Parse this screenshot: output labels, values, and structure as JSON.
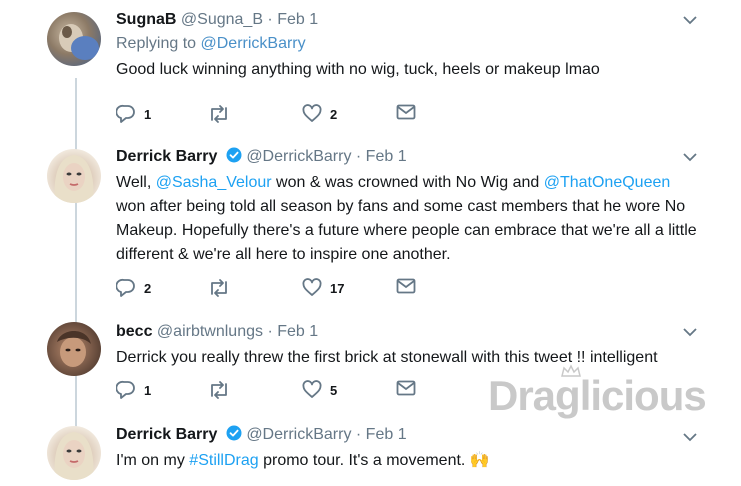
{
  "tweets": [
    {
      "name": "SugnaB",
      "handle": "@Sugna_B",
      "sep": " · ",
      "date": "Feb 1",
      "verified": false,
      "reply_prefix": "Replying to ",
      "reply_handle": "@DerrickBarry",
      "text": "Good luck winning anything with no wig, tuck, heels or makeup lmao",
      "replies": "1",
      "retweets": "",
      "likes": "2"
    },
    {
      "name": "Derrick Barry",
      "handle": "@DerrickBarry",
      "sep": " · ",
      "date": "Feb 1",
      "verified": true,
      "text_parts": [
        "Well, ",
        "@Sasha_Velour",
        " won & was crowned with No Wig and ",
        "@ThatOneQueen",
        " won after being told all season by fans and some cast members that he wore No Makeup. Hopefully there's a future where people can embrace that we're all a little different & we're all here to inspire one another."
      ],
      "replies": "2",
      "retweets": "",
      "likes": "17"
    },
    {
      "name": "becc",
      "handle": "@airbtwnlungs",
      "sep": " · ",
      "date": "Feb 1",
      "verified": false,
      "text": "Derrick you really threw the first brick at stonewall with this tweet !! intelligent",
      "replies": "1",
      "retweets": "",
      "likes": "5"
    },
    {
      "name": "Derrick Barry",
      "handle": "@DerrickBarry",
      "sep": " · ",
      "date": "Feb 1",
      "verified": true,
      "text_parts": [
        "I'm on my ",
        "#StillDrag",
        " promo tour. It's a movement. ",
        "🙌"
      ]
    }
  ],
  "watermark": "Draglicious",
  "colors": {
    "link": "#1da1f2",
    "muted": "#657786",
    "thread": "#ccd6dd",
    "verified": "#1da1f2"
  },
  "icons": [
    "reply-icon",
    "retweet-icon",
    "like-icon",
    "message-icon",
    "chevron-down-icon",
    "verified-badge-icon"
  ]
}
